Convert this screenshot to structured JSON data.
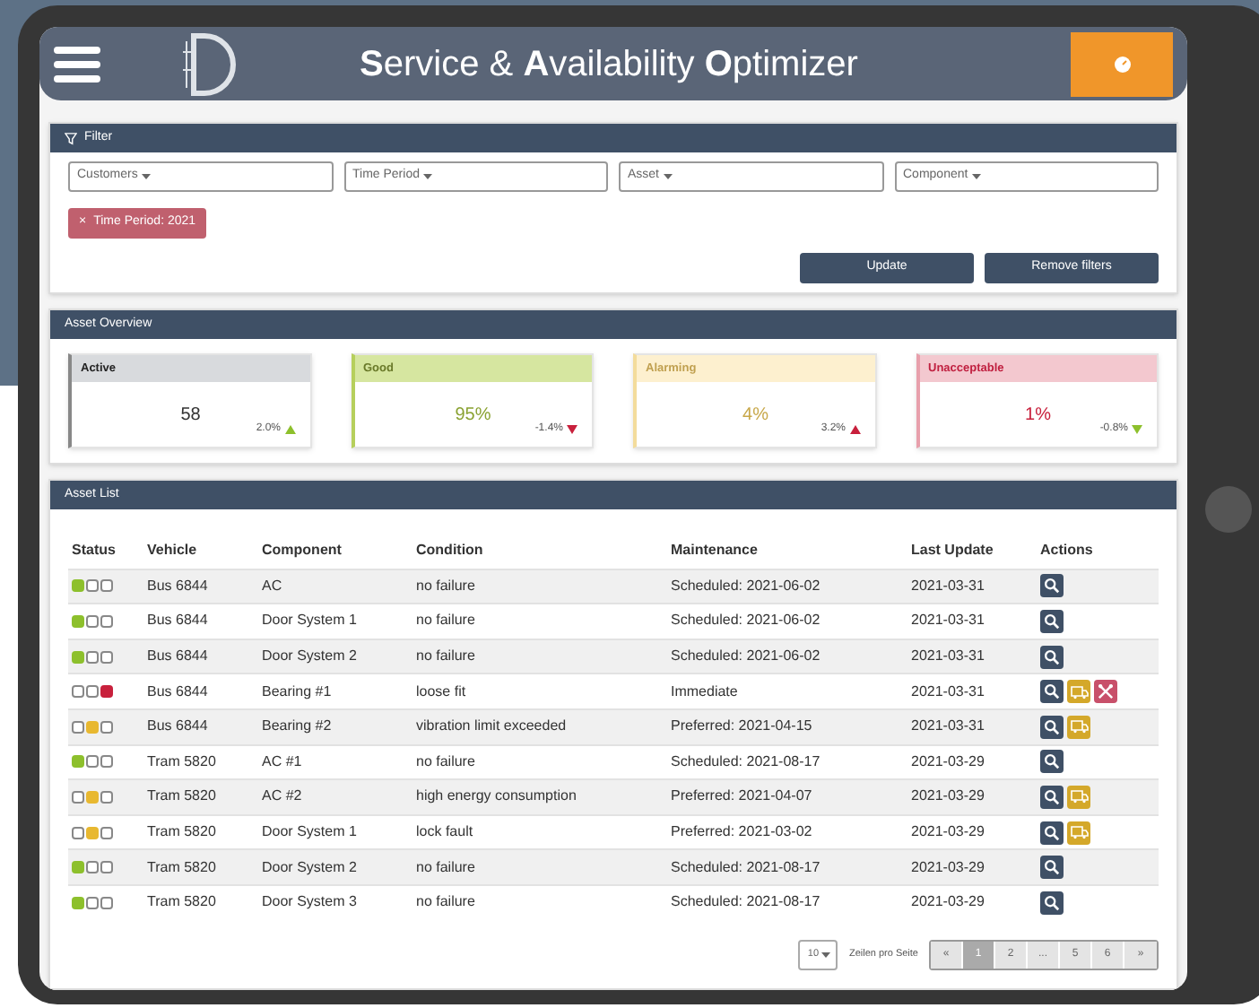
{
  "header": {
    "title": "**S**ervice & **A**vailability **O**ptimizer"
  },
  "filter": {
    "title": "Filter",
    "dropdowns": [
      {
        "label": "Customers"
      },
      {
        "label": "Time Period"
      },
      {
        "label": "Asset"
      },
      {
        "label": "Component"
      }
    ],
    "chips": [
      {
        "label": "Time Period: 2021",
        "remove": "×"
      }
    ],
    "buttons": [
      "Update",
      "Remove filters"
    ]
  },
  "overview": {
    "title": "Asset Overview",
    "cards": [
      {
        "kind": "active",
        "title": "Active",
        "value": "58",
        "delta": "2.0%",
        "rising": true,
        "favorable": true
      },
      {
        "kind": "good",
        "title": "Good",
        "value": "95%",
        "delta": "-1.4%",
        "rising": false,
        "favorable": false
      },
      {
        "kind": "alarming",
        "title": "Alarming",
        "value": "4%",
        "delta": "3.2%",
        "rising": true,
        "favorable": false
      },
      {
        "kind": "unacceptable",
        "title": "Unacceptable",
        "value": "1%",
        "delta": "-0.8%",
        "rising": false,
        "favorable": true
      }
    ]
  },
  "asset_list": {
    "title": "Asset List",
    "columns": [
      "Status",
      "Vehicle",
      "Component",
      "Condition",
      "Maintenance",
      "Last Update",
      "Actions"
    ],
    "rows": [
      {
        "lights": [
          {
            "on": true
          },
          {
            "on": false
          },
          {
            "on": false
          }
        ],
        "vehicle": "Bus 6844",
        "component": "AC",
        "condition": "no failure",
        "maintenance": "Scheduled: 2021-06-02",
        "last_update": "2021-03-31",
        "actions": [
          {
            "kind": "inspect"
          }
        ]
      },
      {
        "lights": [
          {
            "on": true
          },
          {
            "on": false
          },
          {
            "on": false
          }
        ],
        "vehicle": "Bus 6844",
        "component": "Door System 1",
        "condition": "no failure",
        "maintenance": "Scheduled: 2021-06-02",
        "last_update": "2021-03-31",
        "actions": [
          {
            "kind": "inspect"
          }
        ]
      },
      {
        "lights": [
          {
            "on": true
          },
          {
            "on": false
          },
          {
            "on": false
          }
        ],
        "vehicle": "Bus 6844",
        "component": "Door System 2",
        "condition": "no failure",
        "maintenance": "Scheduled: 2021-06-02",
        "last_update": "2021-03-31",
        "actions": [
          {
            "kind": "inspect"
          }
        ]
      },
      {
        "lights": [
          {
            "on": false
          },
          {
            "on": false
          },
          {
            "on": true
          }
        ],
        "vehicle": "Bus 6844",
        "component": "Bearing #1",
        "condition": "loose fit",
        "maintenance": "Immediate",
        "last_update": "2021-03-31",
        "actions": [
          {
            "kind": "inspect"
          },
          {
            "kind": "service"
          },
          {
            "kind": "repair"
          }
        ]
      },
      {
        "lights": [
          {
            "on": false
          },
          {
            "on": true
          },
          {
            "on": false
          }
        ],
        "vehicle": "Bus 6844",
        "component": "Bearing #2",
        "condition": "vibration limit exceeded",
        "maintenance": "Preferred: 2021-04-15",
        "last_update": "2021-03-31",
        "actions": [
          {
            "kind": "inspect"
          },
          {
            "kind": "service"
          }
        ]
      },
      {
        "lights": [
          {
            "on": true
          },
          {
            "on": false
          },
          {
            "on": false
          }
        ],
        "vehicle": "Tram 5820",
        "component": "AC #1",
        "condition": "no failure",
        "maintenance": "Scheduled: 2021-08-17",
        "last_update": "2021-03-29",
        "actions": [
          {
            "kind": "inspect"
          }
        ]
      },
      {
        "lights": [
          {
            "on": false
          },
          {
            "on": true
          },
          {
            "on": false
          }
        ],
        "vehicle": "Tram 5820",
        "component": "AC #2",
        "condition": "high energy consumption",
        "maintenance": "Preferred: 2021-04-07",
        "last_update": "2021-03-29",
        "actions": [
          {
            "kind": "inspect"
          },
          {
            "kind": "service"
          }
        ]
      },
      {
        "lights": [
          {
            "on": false
          },
          {
            "on": true
          },
          {
            "on": false
          }
        ],
        "vehicle": "Tram 5820",
        "component": "Door System 1",
        "condition": "lock fault",
        "maintenance": "Preferred: 2021-03-02",
        "last_update": "2021-03-29",
        "actions": [
          {
            "kind": "inspect"
          },
          {
            "kind": "service"
          }
        ]
      },
      {
        "lights": [
          {
            "on": true
          },
          {
            "on": false
          },
          {
            "on": false
          }
        ],
        "vehicle": "Tram 5820",
        "component": "Door System 2",
        "condition": "no failure",
        "maintenance": "Scheduled: 2021-08-17",
        "last_update": "2021-03-29",
        "actions": [
          {
            "kind": "inspect"
          }
        ]
      },
      {
        "lights": [
          {
            "on": true
          },
          {
            "on": false
          },
          {
            "on": false
          }
        ],
        "vehicle": "Tram 5820",
        "component": "Door System 3",
        "condition": "no failure",
        "maintenance": "Scheduled: 2021-08-17",
        "last_update": "2021-03-29",
        "actions": [
          {
            "kind": "inspect"
          }
        ]
      }
    ],
    "page_size": "10",
    "page_size_label": "Zeilen pro Seite",
    "pages": [
      {
        "label": "«",
        "selected": false
      },
      {
        "label": "1",
        "selected": true
      },
      {
        "label": "2",
        "selected": false
      },
      {
        "label": "...",
        "selected": false
      },
      {
        "label": "5",
        "selected": false
      },
      {
        "label": "6",
        "selected": false
      },
      {
        "label": "»",
        "selected": false
      }
    ]
  }
}
